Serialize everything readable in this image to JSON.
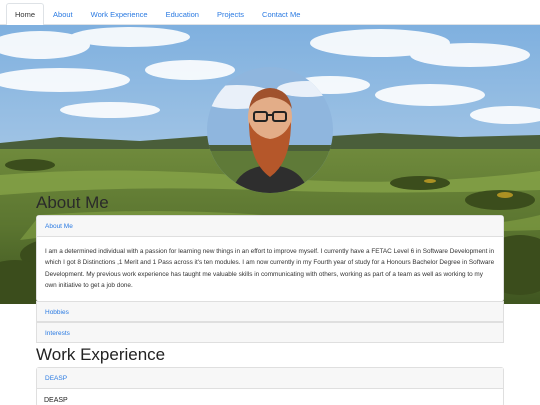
{
  "nav": {
    "tabs": [
      "Home",
      "About",
      "Work Experience",
      "Education",
      "Projects",
      "Contact Me"
    ],
    "active_index": 0
  },
  "colors": {
    "link": "#2a7ae2",
    "sky": "#9ec3e6",
    "grass": "#556b2f",
    "beard": "#b5572a"
  },
  "about": {
    "title": "About Me",
    "card_header": "About Me",
    "card_text": "I am a determined individual with a passion for learning new things in an effort to improve myself. I currently have a FETAC Level 6 in Software Development in which I got 8 Distinctions ,1 Merit and 1 Pass across it's ten modules. I am now currently in my Fourth year of study for a Honours Bachelor Degree in Software Development. My previous work experience has taught me valuable skills in communicating with others, working as part of a team as well as working to my own initiative to get a job done.",
    "accordion": [
      "Hobbies",
      "Interests"
    ]
  },
  "work": {
    "title": "Work Experience",
    "card_header": "DEASP",
    "card_body_heading": "DEASP"
  }
}
